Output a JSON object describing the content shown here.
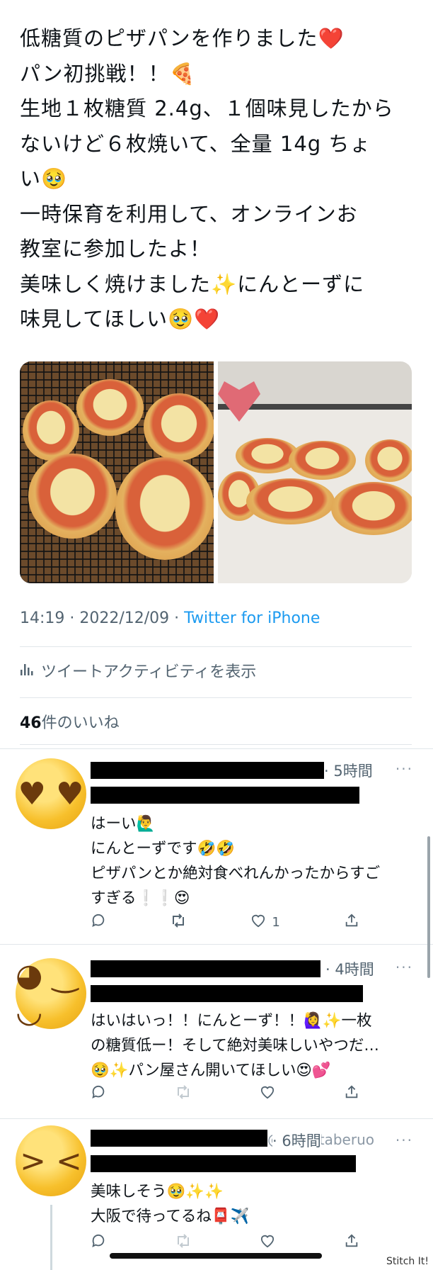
{
  "tweet": {
    "lines": [
      "低糖質のピザパンを作りました❤️",
      "パン初挑戦！！🍕",
      "生地１枚糖質 2.4g、１個味見したから",
      "ないけど６枚焼いて、全量 14g ちょ",
      "い🥹",
      "一時保育を利用して、オンラインお",
      "教室に参加したよ！",
      "美味しく焼けました✨にんとーずに",
      "味見してほしい🥹❤️"
    ],
    "timestamp": "14:19 · 2022/12/09 · ",
    "source": "Twitter for iPhone",
    "activity_label": "ツイートアクティビティを表示",
    "likes_count": "46",
    "likes_label": "件のいいね"
  },
  "replies": [
    {
      "time": "· 5時間",
      "lines": [
        "はーい🙋‍♂️",
        "にんとーずです🤣🤣",
        "ピザパンとか絶対食べれんかったからすご",
        "すぎる❕❕😍"
      ],
      "like_count": "1",
      "avatar": "heart-eyes-face"
    },
    {
      "time": "· 4時間",
      "lines": [
        "はいはいっ！！にんとーず！！🙋‍♀️✨一枚",
        "の糖質低ー！そして絶対美味しいやつだ…",
        "🥹✨パン屋さん開いてほしい😍💕"
      ],
      "like_count": "",
      "avatar": "winking-tongue-face"
    },
    {
      "time": "· 6時間",
      "handle_fragment": "@yugi_taberuo",
      "lines": [
        "美味しそう🥹✨✨",
        "大阪で待ってるね📮✈️"
      ],
      "like_count": "",
      "avatar": "squinting-grin-face"
    }
  ],
  "more_label": "···",
  "watermark": "Stitch It!",
  "colors": {
    "link": "#1d9bf0",
    "secondary": "#536471",
    "text": "#0f1419"
  }
}
